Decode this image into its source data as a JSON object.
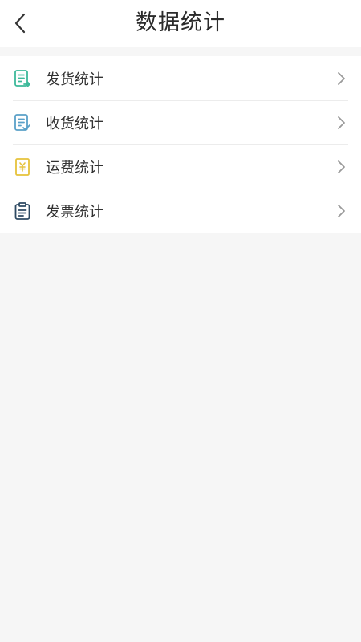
{
  "header": {
    "title": "数据统计",
    "back_icon": "chevron-left-icon"
  },
  "menu": {
    "items": [
      {
        "label": "发货统计",
        "icon": "shipment-list-icon",
        "icon_color": "#3cb99a"
      },
      {
        "label": "收货统计",
        "icon": "receipt-check-icon",
        "icon_color": "#5aa0c8"
      },
      {
        "label": "运费统计",
        "icon": "yuan-receipt-icon",
        "icon_color": "#e6c23a"
      },
      {
        "label": "发票统计",
        "icon": "clipboard-icon",
        "icon_color": "#2e4a63"
      }
    ],
    "chevron_icon": "chevron-right-icon"
  },
  "colors": {
    "background": "#f6f6f6",
    "surface": "#ffffff",
    "divider": "#ececec",
    "text": "#333333",
    "chevron": "#9a9a9a"
  }
}
